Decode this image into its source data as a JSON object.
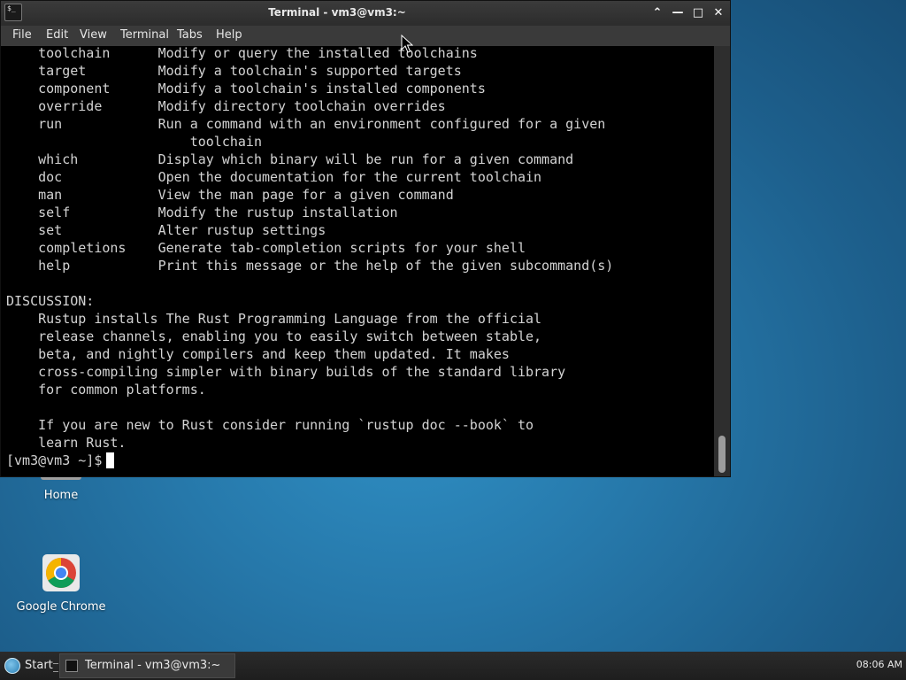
{
  "window": {
    "title": "Terminal - vm3@vm3:~",
    "app_icon_glyph": "$_"
  },
  "menu": {
    "file": "File",
    "edit": "Edit",
    "view": "View",
    "terminal": "Terminal",
    "tabs": "Tabs",
    "help": "Help"
  },
  "window_buttons": {
    "shade": "⌃",
    "minimize": "—",
    "maximize": "□",
    "close": "✕"
  },
  "terminal": {
    "output": "    toolchain      Modify or query the installed toolchains\n    target         Modify a toolchain's supported targets\n    component      Modify a toolchain's installed components\n    override       Modify directory toolchain overrides\n    run            Run a command with an environment configured for a given\n                       toolchain\n    which          Display which binary will be run for a given command\n    doc            Open the documentation for the current toolchain\n    man            View the man page for a given command\n    self           Modify the rustup installation\n    set            Alter rustup settings\n    completions    Generate tab-completion scripts for your shell\n    help           Print this message or the help of the given subcommand(s)\n\nDISCUSSION:\n    Rustup installs The Rust Programming Language from the official\n    release channels, enabling you to easily switch between stable,\n    beta, and nightly compilers and keep them updated. It makes\n    cross-compiling simpler with binary builds of the standard library\n    for common platforms.\n\n    If you are new to Rust consider running `rustup doc --book` to\n    learn Rust.\n",
    "prompt": "[vm3@vm3 ~]$"
  },
  "desktop": {
    "icons": [
      {
        "label": "Home",
        "icon": "home-folder-icon"
      },
      {
        "label": "Google Chrome",
        "icon": "chrome-icon"
      }
    ]
  },
  "taskbar": {
    "start_label": "Start",
    "tasks": [
      {
        "label": "Terminal - vm3@vm3:~",
        "icon": "terminal-icon"
      }
    ],
    "clock": "08:06 AM"
  },
  "colors": {
    "terminal_bg": "#000000",
    "terminal_fg": "#d3d3d3",
    "desktop_accent": "#2678aa",
    "chrome_red": "#db4437",
    "chrome_green": "#0f9d58",
    "chrome_yellow": "#f4b400",
    "chrome_blue": "#4285f4"
  }
}
